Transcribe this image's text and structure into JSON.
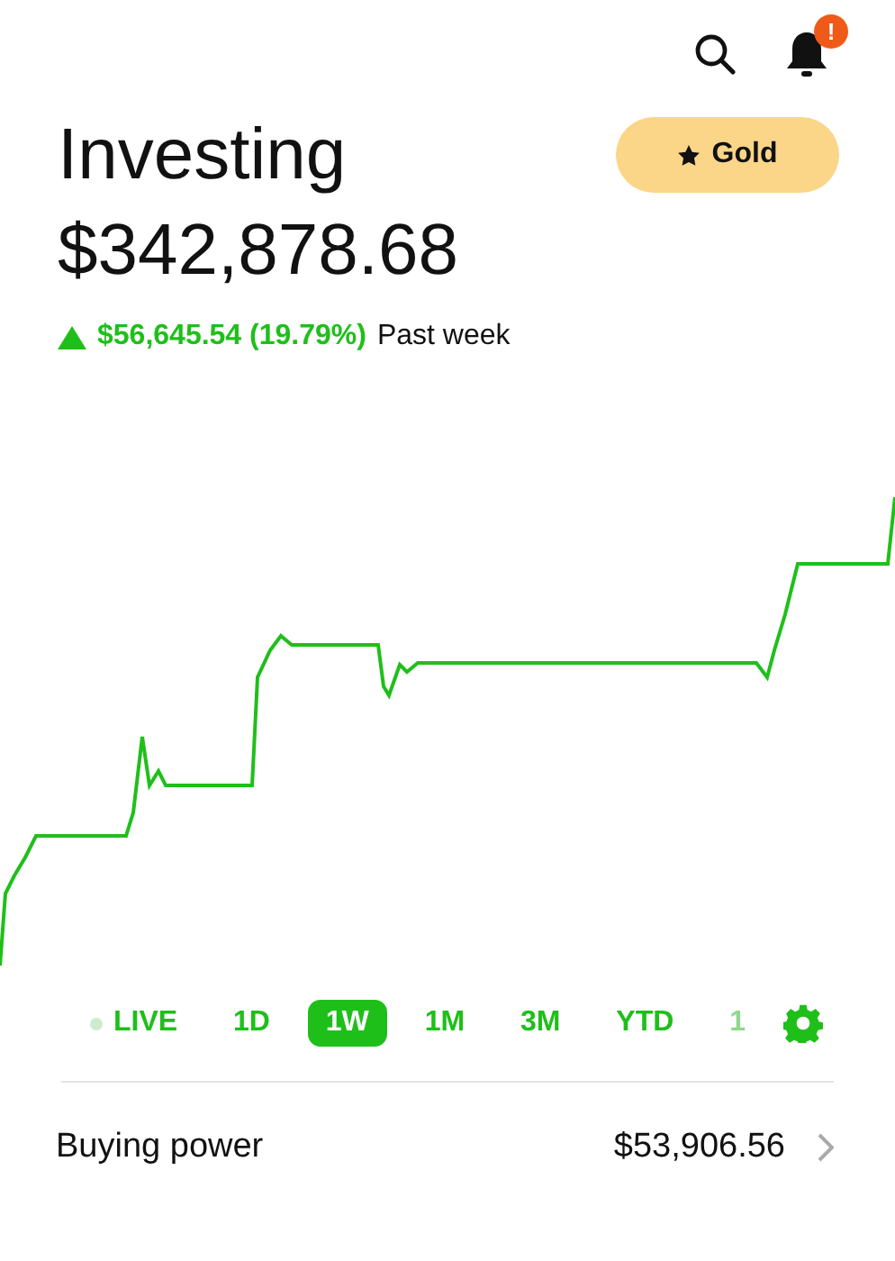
{
  "header": {
    "notification_badge": "!"
  },
  "account": {
    "title": "Investing",
    "gold_button": "Gold",
    "value": "$342,878.68",
    "change": "$56,645.54 (19.79%)",
    "period": "Past week"
  },
  "ranges": [
    {
      "label": "LIVE",
      "kind": "live",
      "selected": false
    },
    {
      "label": "1D",
      "kind": "range",
      "selected": false
    },
    {
      "label": "1W",
      "kind": "range",
      "selected": true
    },
    {
      "label": "1M",
      "kind": "range",
      "selected": false
    },
    {
      "label": "3M",
      "kind": "range",
      "selected": false
    },
    {
      "label": "YTD",
      "kind": "range",
      "selected": false
    },
    {
      "label": "1",
      "kind": "faded",
      "selected": false
    }
  ],
  "buying_power": {
    "label": "Buying power",
    "value": "$53,906.56"
  }
}
